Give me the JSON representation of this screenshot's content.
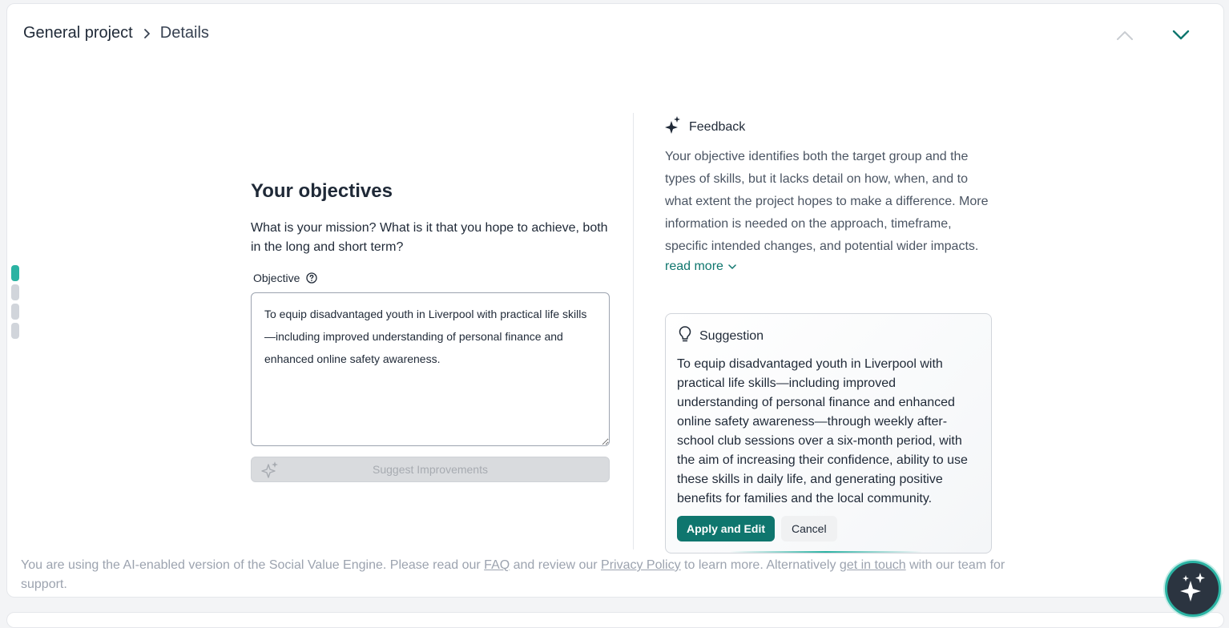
{
  "breadcrumb": {
    "root": "General project",
    "current": "Details"
  },
  "nav": {
    "up_icon": "chevron-up-icon",
    "down_icon": "chevron-down-icon"
  },
  "stepper": {
    "steps": 4,
    "active_index": 0
  },
  "objectives": {
    "title": "Your objectives",
    "description": "What is your mission? What is it that you hope to achieve, both in the long and short term?",
    "field_label": "Objective",
    "field_value": "To equip disadvantaged youth in Liverpool with practical life skills—including improved understanding of personal finance and enhanced online safety awareness.",
    "suggest_button": "Suggest Improvements"
  },
  "feedback": {
    "title": "Feedback",
    "text": "Your objective identifies both the target group and the types of skills, but it lacks detail on how, when, and to what extent the project hopes to make a difference. More information is needed on the approach, timeframe, specific intended changes, and potential wider impacts.",
    "read_more": "read more"
  },
  "suggestion": {
    "title": "Suggestion",
    "text": "To equip disadvantaged youth in Liverpool with practical life skills—including improved understanding of personal finance and enhanced online safety awareness—through weekly after-school club sessions over a six-month period, with the aim of increasing their confidence, ability to use these skills in daily life, and generating positive benefits for families and the local community.",
    "apply_label": "Apply and Edit",
    "cancel_label": "Cancel"
  },
  "footer": {
    "text_1": "You are using the AI-enabled version of the Social Value Engine. Please read our ",
    "faq_link": "FAQ",
    "text_2": " and review our ",
    "privacy_link": "Privacy Policy",
    "text_3": " to learn more. Alternatively ",
    "contact_link": "get in touch",
    "text_4": " with our team for support."
  },
  "colors": {
    "accent": "#0f766e",
    "stepper_active": "#2bb3a3",
    "fab_background": "#2b3440"
  }
}
